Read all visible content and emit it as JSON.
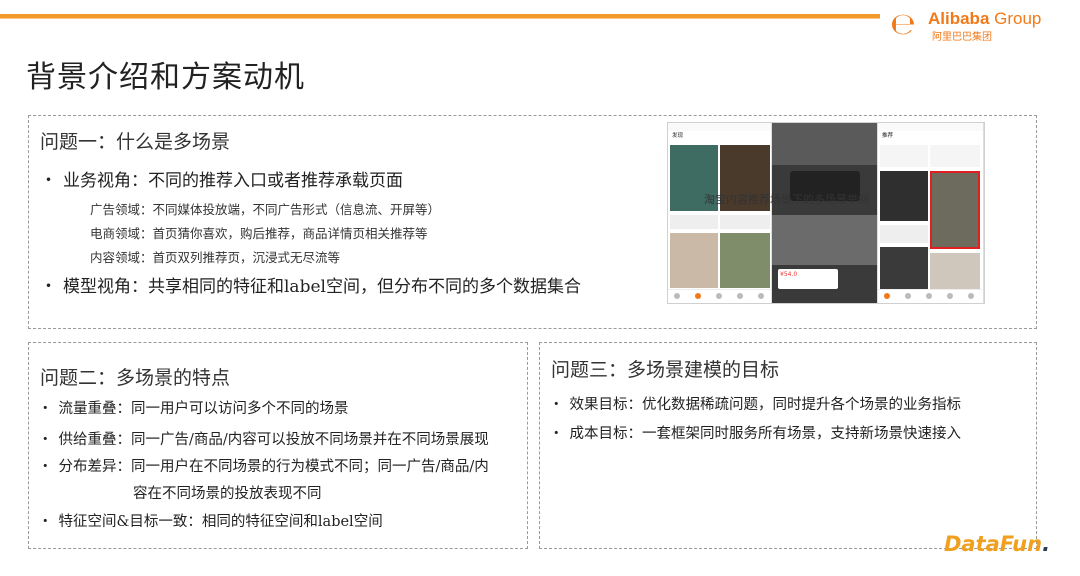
{
  "brand": {
    "name": "Alibaba",
    "group": "Group",
    "cn": "阿里巴巴集团",
    "e_glyph": "℮"
  },
  "page_title": "背景介绍和方案动机",
  "panel1": {
    "title": "问题一：什么是多场景",
    "bullets": [
      "业务视角：不同的推荐入口或者推荐承载页面",
      "模型视角：共享相同的特征和label空间，但分布不同的多个数据集合"
    ],
    "subs": [
      "广告领域：不同媒体投放端，不同广告形式（信息流、开屏等）",
      "电商领域：首页猜你喜欢，购后推荐，商品详情页相关推荐等",
      "内容领域：首页双列推荐页，沉浸式无尽流等"
    ],
    "image_caption": "淘宝内容推荐场景下的多场景举例",
    "screens": {
      "s1_nav": "发现",
      "s3_nav": "推荐",
      "s2_price": "¥54.0"
    }
  },
  "panel2": {
    "title": "问题二：多场景的特点",
    "bullets": [
      "流量重叠：同一用户可以访问多个不同的场景",
      "供给重叠：同一广告/商品/内容可以投放不同场景并在不同场景展现",
      "分布差异：同一用户在不同场景的行为模式不同；同一广告/商品/内",
      "容在不同场景的投放表现不同",
      "特征空间&目标一致：相同的特征空间和label空间"
    ]
  },
  "panel3": {
    "title": "问题三：多场景建模的目标",
    "bullets": [
      "效果目标：优化数据稀疏问题，同时提升各个场景的业务指标",
      "成本目标：一套框架同时服务所有场景，支持新场景快速接入"
    ]
  },
  "footer": {
    "logo_a": "DataFun",
    "logo_b": "."
  },
  "colors": {
    "accent": "#f39a2b",
    "brand": "#f07a1a"
  }
}
